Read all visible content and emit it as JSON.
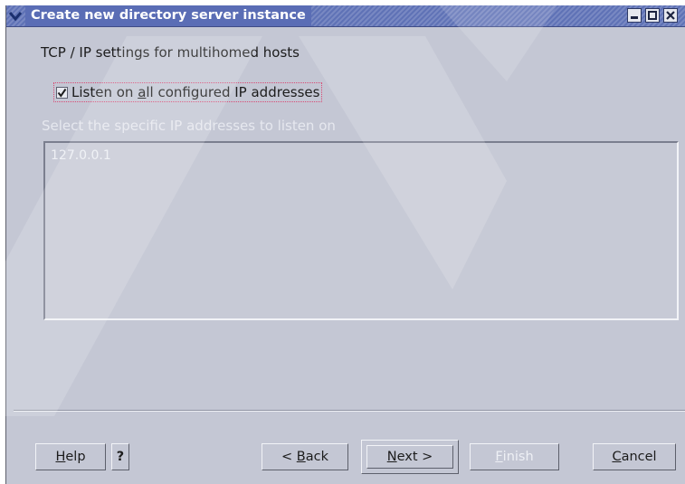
{
  "window": {
    "title": "Create new directory server instance",
    "controls": {
      "minimize": "▬",
      "maximize": "☐",
      "close": "✖"
    }
  },
  "section": {
    "title": "TCP / IP settings for multihomed hosts"
  },
  "listen_all": {
    "label_pre": "Listen on ",
    "label_mnemonic": "a",
    "label_post": "ll configured IP addresses",
    "checked": true
  },
  "ip_select": {
    "label": "Select the specific IP addresses to listen on",
    "items": [
      "127.0.0.1"
    ],
    "enabled": false
  },
  "buttons": {
    "help": {
      "mnemonic": "H",
      "rest": "elp"
    },
    "question": "?",
    "back": {
      "pre": "< ",
      "mnemonic": "B",
      "rest": "ack"
    },
    "next": {
      "mnemonic": "N",
      "rest": "ext >"
    },
    "finish": {
      "mnemonic": "F",
      "rest": "inish",
      "enabled": false
    },
    "cancel": {
      "mnemonic": "C",
      "rest": "ancel"
    }
  },
  "icons": {
    "window_menu": "chevron-down-icon",
    "minimize": "minimize-icon",
    "maximize": "maximize-icon",
    "close": "close-icon",
    "check": "checkmark-icon"
  },
  "colors": {
    "window_bg": "#c4c7d4",
    "titlebar": "#5a6db5",
    "disabled_text": "#e6e8ef"
  }
}
